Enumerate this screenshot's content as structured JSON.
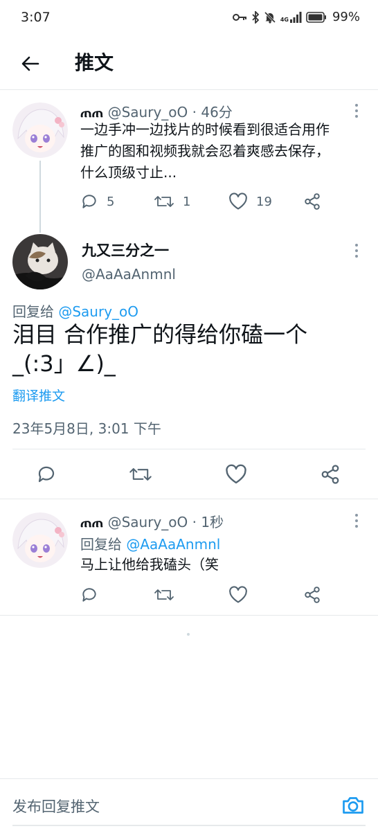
{
  "status_bar": {
    "time": "3:07",
    "network": "4G",
    "battery": "99%"
  },
  "header": {
    "title": "推文"
  },
  "original_tweet": {
    "name": "ጠጠ",
    "handle": "@Saury_oO",
    "time": "46分",
    "text_lines": [
      "一边手冲一边找片的时候看到很适合用作",
      "推广的图和视频我就会忍着爽感去保存，",
      "什么顶级寸止..."
    ],
    "replies": "5",
    "retweets": "1",
    "likes": "19"
  },
  "focus_tweet": {
    "name": "九又三分之一",
    "handle": "@AaAaAnmnl",
    "reply_prefix": "回复给",
    "reply_to": "@Saury_oO",
    "text_lines": [
      "泪目 合作推广的得给你磕一个",
      "_(:3」∠)_"
    ],
    "translate_label": "翻译推文",
    "timestamp": "23年5月8日, 3:01 下午"
  },
  "reply_tweet": {
    "name": "ጠጠ",
    "handle": "@Saury_oO",
    "time": "1秒",
    "reply_prefix": "回复给",
    "reply_to": "@AaAaAnmnl",
    "text": "马上让他给我磕头（笑"
  },
  "reply_bar": {
    "placeholder": "发布回复推文"
  },
  "colors": {
    "accent": "#1d9bf0",
    "muted": "#536471",
    "divider": "#e6e9eb"
  }
}
